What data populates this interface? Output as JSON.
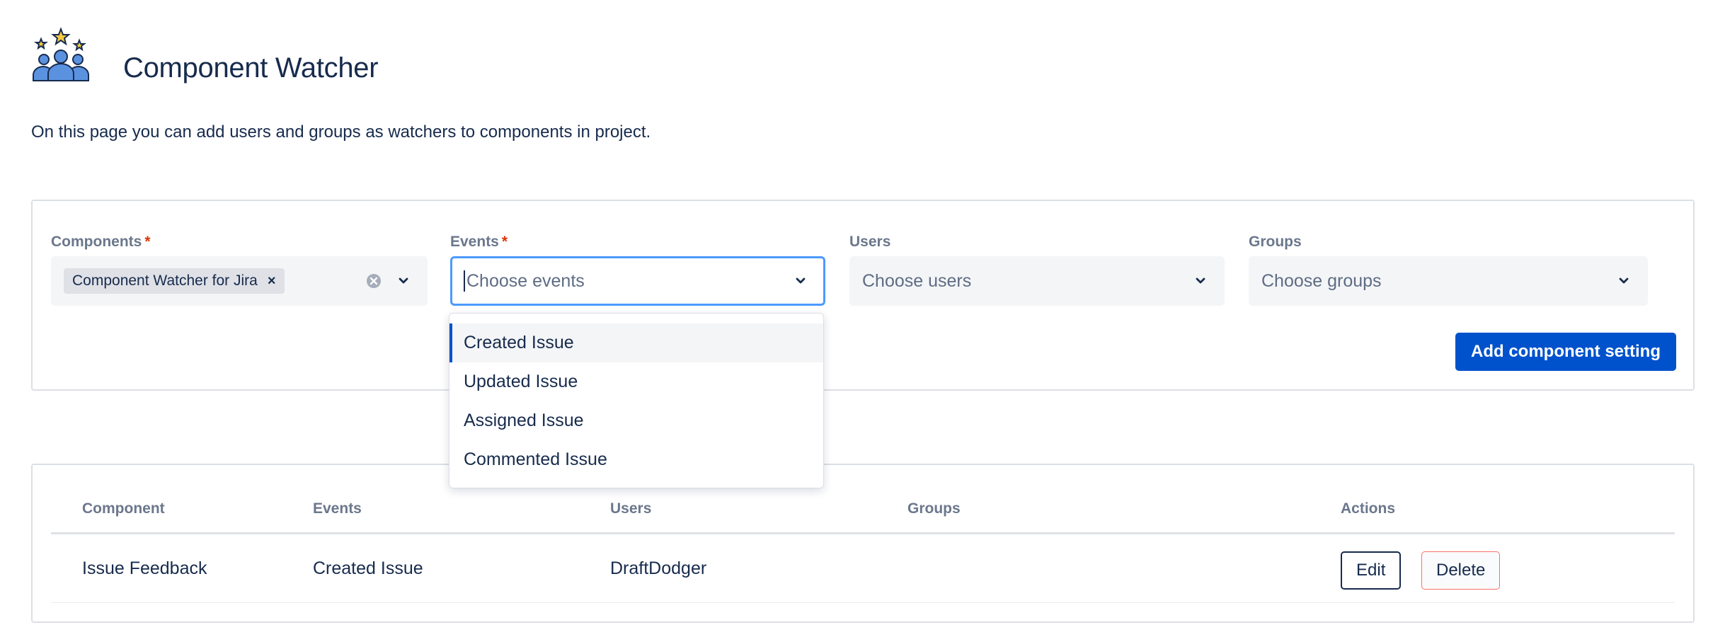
{
  "header": {
    "title": "Component Watcher",
    "logo_icon": "watchers-with-stars-icon"
  },
  "description": "On this page you can add users and groups as watchers to components in project.",
  "form": {
    "components": {
      "label": "Components",
      "required_mark": "*",
      "selected_tag": "Component Watcher for Jira",
      "tag_remove": "×"
    },
    "events": {
      "label": "Events",
      "required_mark": "*",
      "placeholder": "Choose events"
    },
    "users": {
      "label": "Users",
      "placeholder": "Choose users"
    },
    "groups": {
      "label": "Groups",
      "placeholder": "Choose groups"
    },
    "add_button": "Add component setting"
  },
  "events_dropdown": {
    "options": [
      "Created Issue",
      "Updated Issue",
      "Assigned Issue",
      "Commented Issue"
    ],
    "active_index": 0
  },
  "table": {
    "headers": [
      "Component",
      "Events",
      "Users",
      "Groups",
      "Actions"
    ],
    "rows": [
      {
        "component": "Issue Feedback",
        "events": "Created Issue",
        "users": "DraftDodger",
        "groups": "",
        "edit_label": "Edit",
        "delete_label": "Delete"
      }
    ]
  },
  "colors": {
    "primary": "#0052cc",
    "focus": "#4c9aff",
    "required": "#de350b",
    "danger_border": "#f87168",
    "text": "#172b4d"
  }
}
